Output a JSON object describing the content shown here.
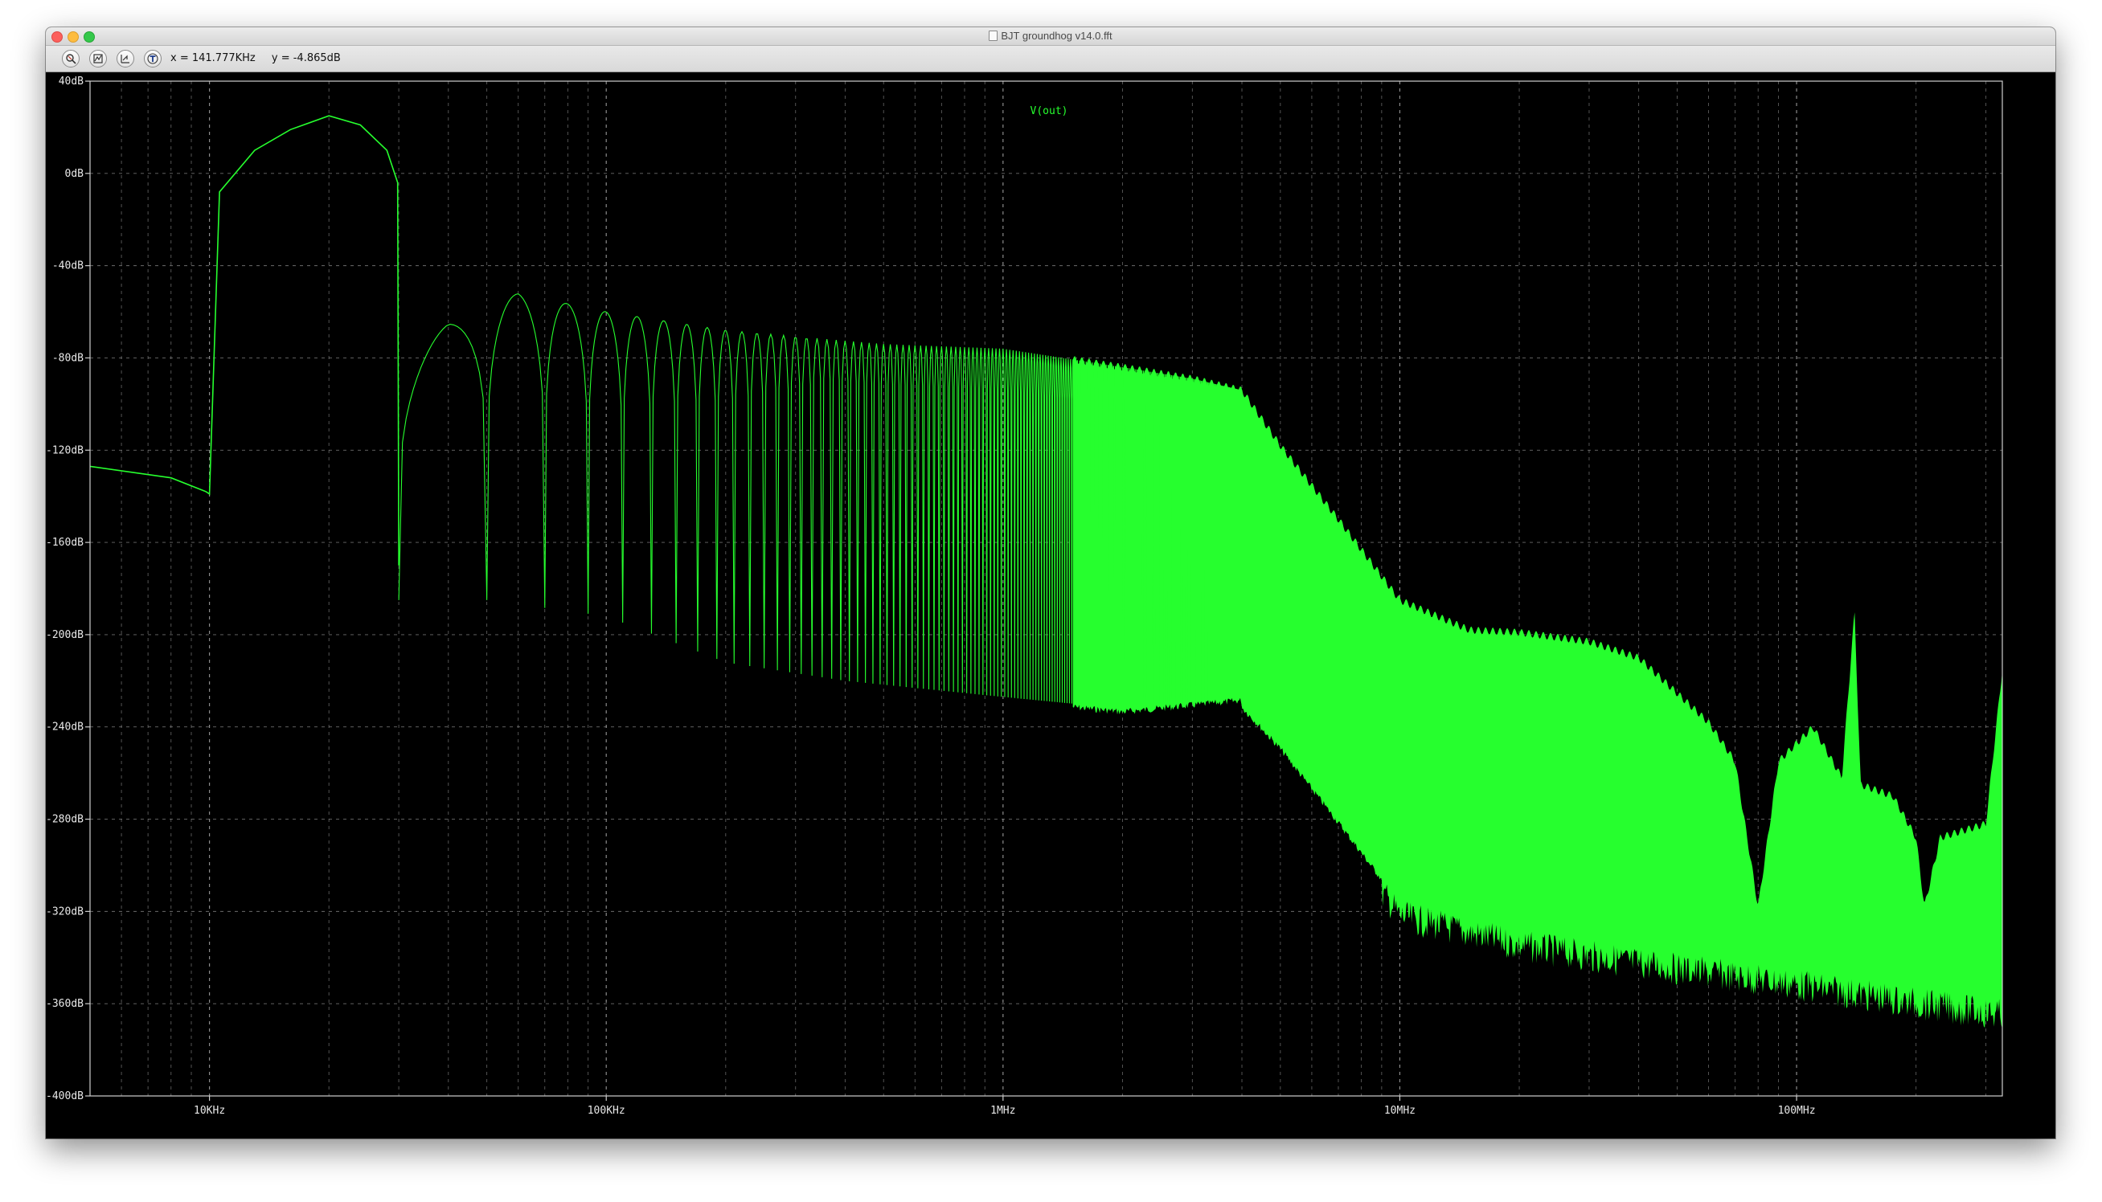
{
  "window": {
    "title": "BJT groundhog v14.0.fft"
  },
  "toolbar": {
    "buttons": [
      {
        "icon": "zoom-icon"
      },
      {
        "icon": "autoscale-icon"
      },
      {
        "icon": "undo-zoom-icon"
      },
      {
        "icon": "label-icon"
      }
    ],
    "cursor_x": "x = 141.777KHz",
    "cursor_y": "y = -4.865dB"
  },
  "colors": {
    "background": "#000000",
    "trace": "#26ff2e",
    "grid": "#9a9a9a",
    "axis_text": "#e8e8e8"
  },
  "chart_data": {
    "type": "line",
    "title": "V(out)",
    "x_scale": "log",
    "xlim": [
      5000,
      330000000
    ],
    "ylim": [
      -400,
      40
    ],
    "y_ticks": [
      40,
      0,
      -40,
      -80,
      -120,
      -160,
      -200,
      -240,
      -280,
      -320,
      -360,
      -400
    ],
    "y_tick_labels": [
      "40dB",
      "0dB",
      "-40dB",
      "-80dB",
      "-120dB",
      "-160dB",
      "-200dB",
      "-240dB",
      "-280dB",
      "-320dB",
      "-360dB",
      "-400dB"
    ],
    "x_ticks": [
      10000,
      100000,
      1000000,
      10000000,
      100000000
    ],
    "x_tick_labels": [
      "10KHz",
      "100KHz",
      "1MHz",
      "10MHz",
      "100MHz"
    ],
    "grid": true,
    "series": [
      {
        "name": "V(out)",
        "fundamental_band": [
          [
            5000,
            -127
          ],
          [
            8000,
            -132
          ],
          [
            9800,
            -138
          ],
          [
            10000,
            -139
          ],
          [
            10600,
            -8
          ],
          [
            13000,
            10
          ],
          [
            16000,
            19
          ],
          [
            20000,
            25
          ],
          [
            24000,
            21
          ],
          [
            28000,
            10
          ],
          [
            29800,
            -4
          ],
          [
            30000,
            -170
          ]
        ],
        "lobe_peak_envelope": [
          [
            30000,
            -88
          ],
          [
            40000,
            -65
          ],
          [
            60000,
            -52
          ],
          [
            100000,
            -60
          ],
          [
            200000,
            -68
          ],
          [
            500000,
            -74
          ],
          [
            1000000,
            -76
          ],
          [
            2000000,
            -84
          ],
          [
            3000000,
            -89
          ],
          [
            4000000,
            -94
          ]
        ],
        "lobe_floor_envelope": [
          [
            50000,
            -185
          ],
          [
            100000,
            -192
          ],
          [
            200000,
            -212
          ],
          [
            400000,
            -220
          ],
          [
            1000000,
            -227
          ],
          [
            2000000,
            -232
          ],
          [
            4000000,
            -227
          ]
        ],
        "fill_upper_envelope": [
          [
            4000000,
            -94
          ],
          [
            5000000,
            -118
          ],
          [
            7000000,
            -150
          ],
          [
            10000000,
            -185
          ],
          [
            15000000,
            -198
          ],
          [
            20000000,
            -199
          ],
          [
            30000000,
            -203
          ],
          [
            40000000,
            -210
          ],
          [
            60000000,
            -238
          ],
          [
            70000000,
            -255
          ],
          [
            80000000,
            -318
          ],
          [
            90000000,
            -255
          ],
          [
            110000000,
            -240
          ],
          [
            130000000,
            -262
          ],
          [
            140000000,
            -190
          ],
          [
            145000000,
            -265
          ],
          [
            175000000,
            -270
          ],
          [
            200000000,
            -288
          ],
          [
            210000000,
            -318
          ],
          [
            230000000,
            -288
          ],
          [
            300000000,
            -282
          ],
          [
            330000000,
            -215
          ]
        ],
        "fill_lower_envelope": [
          [
            4000000,
            -230
          ],
          [
            5000000,
            -248
          ],
          [
            7000000,
            -280
          ],
          [
            10000000,
            -315
          ],
          [
            20000000,
            -328
          ],
          [
            50000000,
            -338
          ],
          [
            100000000,
            -345
          ],
          [
            200000000,
            -353
          ],
          [
            330000000,
            -358
          ]
        ]
      }
    ]
  }
}
